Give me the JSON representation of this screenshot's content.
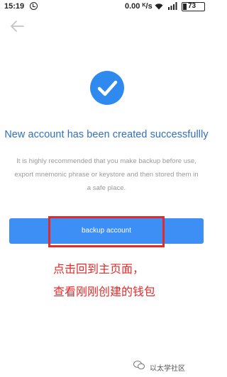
{
  "status_bar": {
    "time": "15:19",
    "network_speed": "0.00 ᴷ/s",
    "battery": "73"
  },
  "page": {
    "title": "New account has been created successfullly",
    "description": "It is highly recommended that you make backup before use, export mnemonic phrase or keystore and then stored them in a safe place.",
    "backup_button_label": "backup account"
  },
  "annotation": {
    "line1": "点击回到主页面，",
    "line2": "查看刚刚创建的钱包"
  },
  "watermark": {
    "text": "以太学社区"
  },
  "colors": {
    "accent": "#2f8af0",
    "button": "#3d8ff5",
    "annotation": "#e12a2a",
    "title": "#2f6fbf"
  }
}
